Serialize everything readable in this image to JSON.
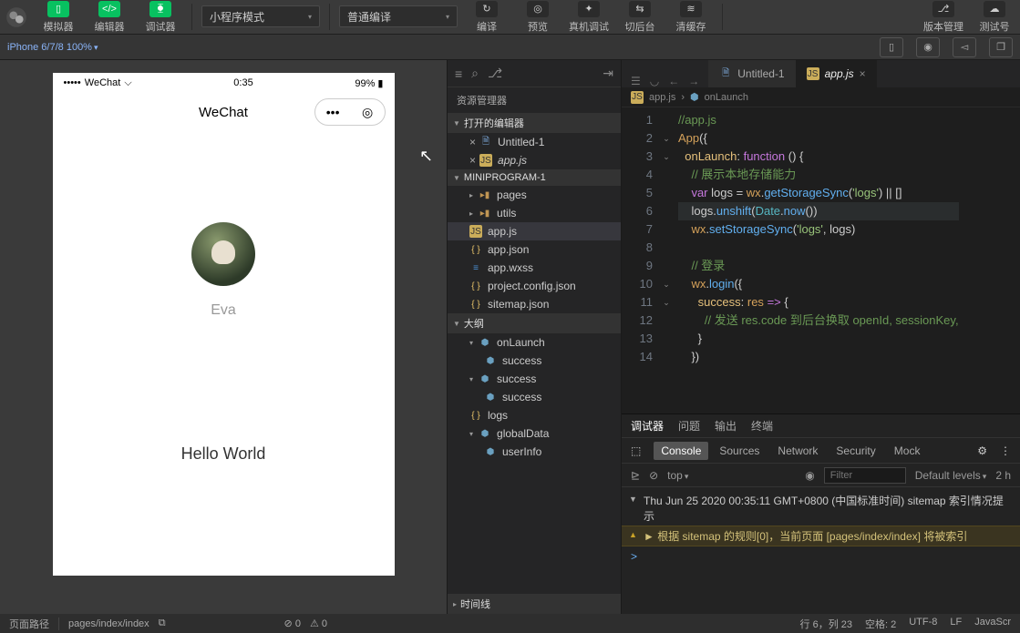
{
  "toolbar": {
    "buttons": [
      {
        "label": "模拟器"
      },
      {
        "label": "编辑器"
      },
      {
        "label": "调试器"
      }
    ],
    "mode_select": "小程序模式",
    "compile_select": "普通编译",
    "actions": [
      {
        "label": "编译"
      },
      {
        "label": "预览"
      },
      {
        "label": "真机调试"
      },
      {
        "label": "切后台"
      },
      {
        "label": "清缓存"
      }
    ],
    "right_actions": [
      {
        "label": "版本管理"
      },
      {
        "label": "测试号"
      }
    ]
  },
  "devbar": {
    "device": "iPhone 6/7/8 100%"
  },
  "simulator": {
    "carrier": "WeChat",
    "time": "0:35",
    "battery": "99%",
    "title": "WeChat",
    "username": "Eva",
    "body_text": "Hello World"
  },
  "explorer": {
    "title": "资源管理器",
    "open_editors": "打开的编辑器",
    "open": [
      {
        "icon": "file",
        "label": "Untitled-1"
      },
      {
        "icon": "js",
        "label": "app.js",
        "italic": true
      }
    ],
    "project": "MINIPROGRAM-1",
    "tree": [
      {
        "depth": 1,
        "icon": "folder",
        "label": "pages",
        "expand": "▸"
      },
      {
        "depth": 1,
        "icon": "folder",
        "label": "utils",
        "expand": "▸"
      },
      {
        "depth": 1,
        "icon": "js",
        "label": "app.js",
        "sel": true
      },
      {
        "depth": 1,
        "icon": "json",
        "label": "app.json"
      },
      {
        "depth": 1,
        "icon": "wxss",
        "label": "app.wxss"
      },
      {
        "depth": 1,
        "icon": "json",
        "label": "project.config.json"
      },
      {
        "depth": 1,
        "icon": "json",
        "label": "sitemap.json"
      }
    ],
    "outline": "大纲",
    "outline_items": [
      {
        "depth": 1,
        "icon": "cube",
        "label": "onLaunch",
        "expand": "▾"
      },
      {
        "depth": 2,
        "icon": "cube",
        "label": "success"
      },
      {
        "depth": 1,
        "icon": "cube",
        "label": "success",
        "expand": "▾"
      },
      {
        "depth": 2,
        "icon": "cube",
        "label": "success"
      },
      {
        "depth": 1,
        "icon": "json",
        "label": "logs"
      },
      {
        "depth": 1,
        "icon": "cube",
        "label": "globalData",
        "expand": "▾"
      },
      {
        "depth": 2,
        "icon": "cube",
        "label": "userInfo"
      }
    ],
    "timeline": "时间线"
  },
  "editor": {
    "tabs": [
      {
        "label": "Untitled-1",
        "icon": "file"
      },
      {
        "label": "app.js",
        "icon": "js",
        "active": true,
        "italic": true
      }
    ],
    "breadcrumb": [
      "app.js",
      "onLaunch"
    ],
    "code_lines": [
      {
        "n": 1,
        "html": "<span class='c-comm'>//app.js</span>"
      },
      {
        "n": 2,
        "fold": "⌄",
        "html": "<span class='c-ident'>App</span>({"
      },
      {
        "n": 3,
        "fold": "⌄",
        "html": "  <span class='c-prop'>onLaunch</span>: <span class='c-kw'>function</span> () {"
      },
      {
        "n": 4,
        "html": "    <span class='c-comm'>// 展示本地存储能力</span>"
      },
      {
        "n": 5,
        "html": "    <span class='c-kw'>var</span> logs = <span class='c-ident'>wx</span>.<span class='c-func'>getStorageSync</span>(<span class='c-str'>'logs'</span>) || []"
      },
      {
        "n": 6,
        "hl": true,
        "html": "    logs.<span class='c-func'>unshift</span>(<span class='c-obj'>Date</span>.<span class='c-func'>now</span>())"
      },
      {
        "n": 7,
        "html": "    <span class='c-ident'>wx</span>.<span class='c-func'>setStorageSync</span>(<span class='c-str'>'logs'</span>, logs)"
      },
      {
        "n": 8,
        "html": ""
      },
      {
        "n": 9,
        "html": "    <span class='c-comm'>// 登录</span>"
      },
      {
        "n": 10,
        "fold": "⌄",
        "html": "    <span class='c-ident'>wx</span>.<span class='c-func'>login</span>({"
      },
      {
        "n": 11,
        "fold": "⌄",
        "html": "      <span class='c-prop'>success</span>: <span class='c-ident'>res</span> <span class='c-kw'>=&gt;</span> {"
      },
      {
        "n": 12,
        "html": "        <span class='c-comm'>// 发送 res.code 到后台换取 openId, sessionKey,</span>"
      },
      {
        "n": 13,
        "html": "      }"
      },
      {
        "n": 14,
        "html": "    })"
      }
    ]
  },
  "debugger": {
    "tabs": [
      "调试器",
      "问题",
      "输出",
      "终端"
    ],
    "subtabs": [
      "Console",
      "Sources",
      "Network",
      "Security",
      "Mock"
    ],
    "top": "top",
    "filter_placeholder": "Filter",
    "levels": "Default levels",
    "hidden": "2 h",
    "log_head": "Thu Jun 25 2020 00:35:11 GMT+0800 (中国标准时间) sitemap 索引情况提示",
    "log_warn": "► 根据 sitemap 的规则[0]，当前页面 [pages/index/index] 将被索引",
    "prompt": ">"
  },
  "status": {
    "left_label": "页面路径",
    "path": "pages/index/index",
    "err": "⊘ 0",
    "warn": "⚠ 0",
    "pos": "行 6，列 23",
    "spaces": "空格: 2",
    "enc": "UTF-8",
    "eol": "LF",
    "lang": "JavaScr"
  }
}
